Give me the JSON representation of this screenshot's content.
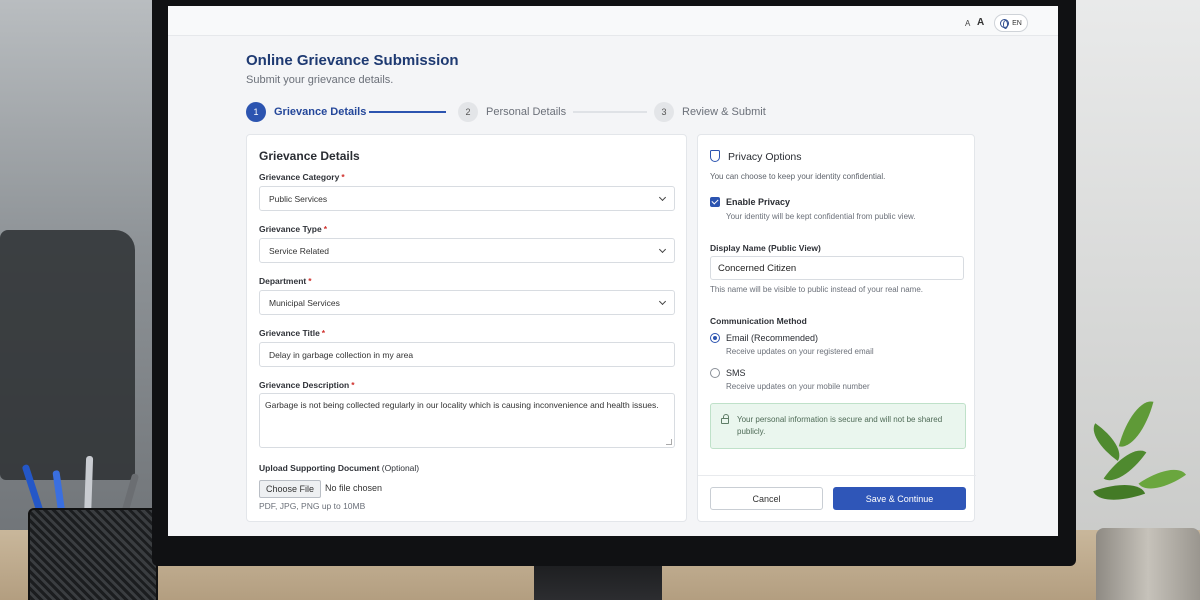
{
  "header": {
    "font_small": "A",
    "font_large": "A",
    "language": "EN"
  },
  "page": {
    "title": "Online Grievance Submission",
    "subtitle": "Submit your grievance details."
  },
  "stepper": [
    {
      "number": "1",
      "label": "Grievance Details",
      "state": "active"
    },
    {
      "number": "2",
      "label": "Personal Details",
      "state": "idle"
    },
    {
      "number": "3",
      "label": "Review & Submit",
      "state": "idle"
    }
  ],
  "grievance": {
    "title": "Grievance Details",
    "category": {
      "label": "Grievance Category",
      "required": "*",
      "value": "Public Services"
    },
    "type": {
      "label": "Grievance Type",
      "required": "*",
      "value": "Service Related"
    },
    "department": {
      "label": "Department",
      "required": "*",
      "value": "Municipal Services"
    },
    "gtitle": {
      "label": "Grievance Title",
      "required": "*",
      "value": "Delay in garbage collection in my area"
    },
    "description": {
      "label": "Grievance Description",
      "required": "*",
      "value": "Garbage is not being collected regularly in our locality which is causing inconvenience and health issues."
    },
    "upload": {
      "label": "Upload Supporting Document",
      "optional": "(Optional)",
      "button": "Choose File",
      "status": "No file chosen",
      "hint": "PDF, JPG, PNG up to 10MB"
    }
  },
  "privacy": {
    "title": "Privacy Options",
    "description": "You can choose to keep your identity confidential.",
    "enable_label": "Enable Privacy",
    "enable_checked": true,
    "enable_hint": "Your identity will be kept confidential from public view.",
    "display_name_label": "Display Name (Public View)",
    "display_name_value": "Concerned Citizen",
    "display_name_hint": "This name will be visible to public instead of your real name.",
    "communication_label": "Communication Method",
    "options": [
      {
        "label": "Email (Recommended)",
        "hint": "Receive updates on your registered email",
        "selected": true
      },
      {
        "label": "SMS",
        "hint": "Receive updates on your mobile number",
        "selected": false
      }
    ],
    "secure_notice": "Your personal information is secure and will not be shared publicly."
  },
  "actions": {
    "cancel": "Cancel",
    "save": "Save & Continue"
  },
  "colors": {
    "primary": "#2c54b0",
    "title": "#1e3a72",
    "success_bg": "#eaf6ee"
  }
}
